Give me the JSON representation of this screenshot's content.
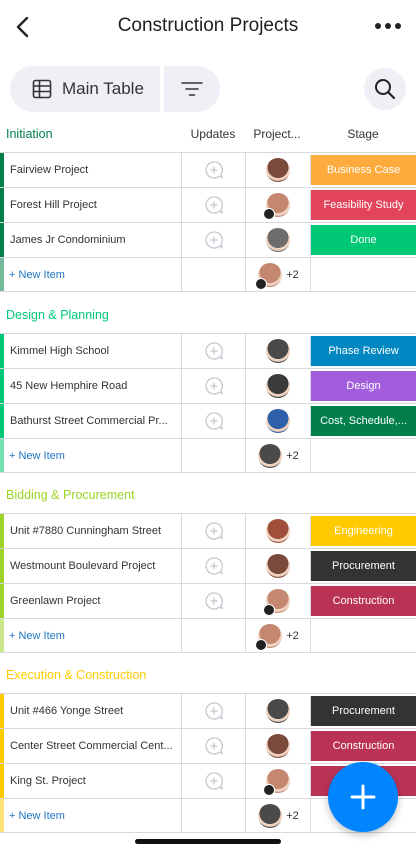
{
  "header": {
    "title": "Construction Projects"
  },
  "toolbar": {
    "view_label": "Main Table"
  },
  "columns": {
    "updates": "Updates",
    "person": "Project...",
    "stage": "Stage"
  },
  "new_item_label": "+ New Item",
  "groups": [
    {
      "title": "Initiation",
      "color": "#037f4c",
      "rows": [
        {
          "name": "Fairview Project",
          "stage": "Business Case",
          "stage_color": "#fdab3d",
          "avatar_color": "#7a4a3a"
        },
        {
          "name": "Forest Hill Project",
          "stage": "Feasibility Study",
          "stage_color": "#e2445c",
          "avatar_color": "#c48870"
        },
        {
          "name": "James Jr Condominium",
          "stage": "Done",
          "stage_color": "#00c875",
          "avatar_color": "#6d6d6d"
        }
      ],
      "new_row": {
        "extra": "+2"
      }
    },
    {
      "title": "Design & Planning",
      "color": "#00c875",
      "rows": [
        {
          "name": "Kimmel High School",
          "stage": "Phase Review",
          "stage_color": "#0086c0",
          "avatar_color": "#4a4a4a"
        },
        {
          "name": "45 New Hemphire Road",
          "stage": "Design",
          "stage_color": "#a25ddc",
          "avatar_color": "#3b3b3b"
        },
        {
          "name": "Bathurst Street Commercial Pr...",
          "stage": "Cost, Schedule,...",
          "stage_color": "#037f4c",
          "avatar_color": "#2f5fa8"
        }
      ],
      "new_row": {
        "extra": "+2"
      }
    },
    {
      "title": "Bidding & Procurement",
      "color": "#9cd326",
      "rows": [
        {
          "name": "Unit #7880 Cunningham Street",
          "stage": "Engineering",
          "stage_color": "#ffcb00",
          "avatar_color": "#a0503a"
        },
        {
          "name": "Westmount Boulevard Project",
          "stage": "Procurement",
          "stage_color": "#333333",
          "avatar_color": "#7a4a3a"
        },
        {
          "name": "Greenlawn Project",
          "stage": "Construction",
          "stage_color": "#bb3354",
          "avatar_color": "#c48870"
        }
      ],
      "new_row": {
        "extra": "+2"
      }
    },
    {
      "title": "Execution & Construction",
      "color": "#ffcb00",
      "rows": [
        {
          "name": "Unit #466 Yonge Street",
          "stage": "Procurement",
          "stage_color": "#333333",
          "avatar_color": "#4a4a4a"
        },
        {
          "name": "Center Street Commercial Cent...",
          "stage": "Construction",
          "stage_color": "#bb3354",
          "avatar_color": "#7a4a3a"
        },
        {
          "name": "King St. Project",
          "stage": "C",
          "stage_color": "#bb3354",
          "avatar_color": "#c48870"
        }
      ],
      "new_row": {
        "extra": "+2"
      }
    }
  ]
}
